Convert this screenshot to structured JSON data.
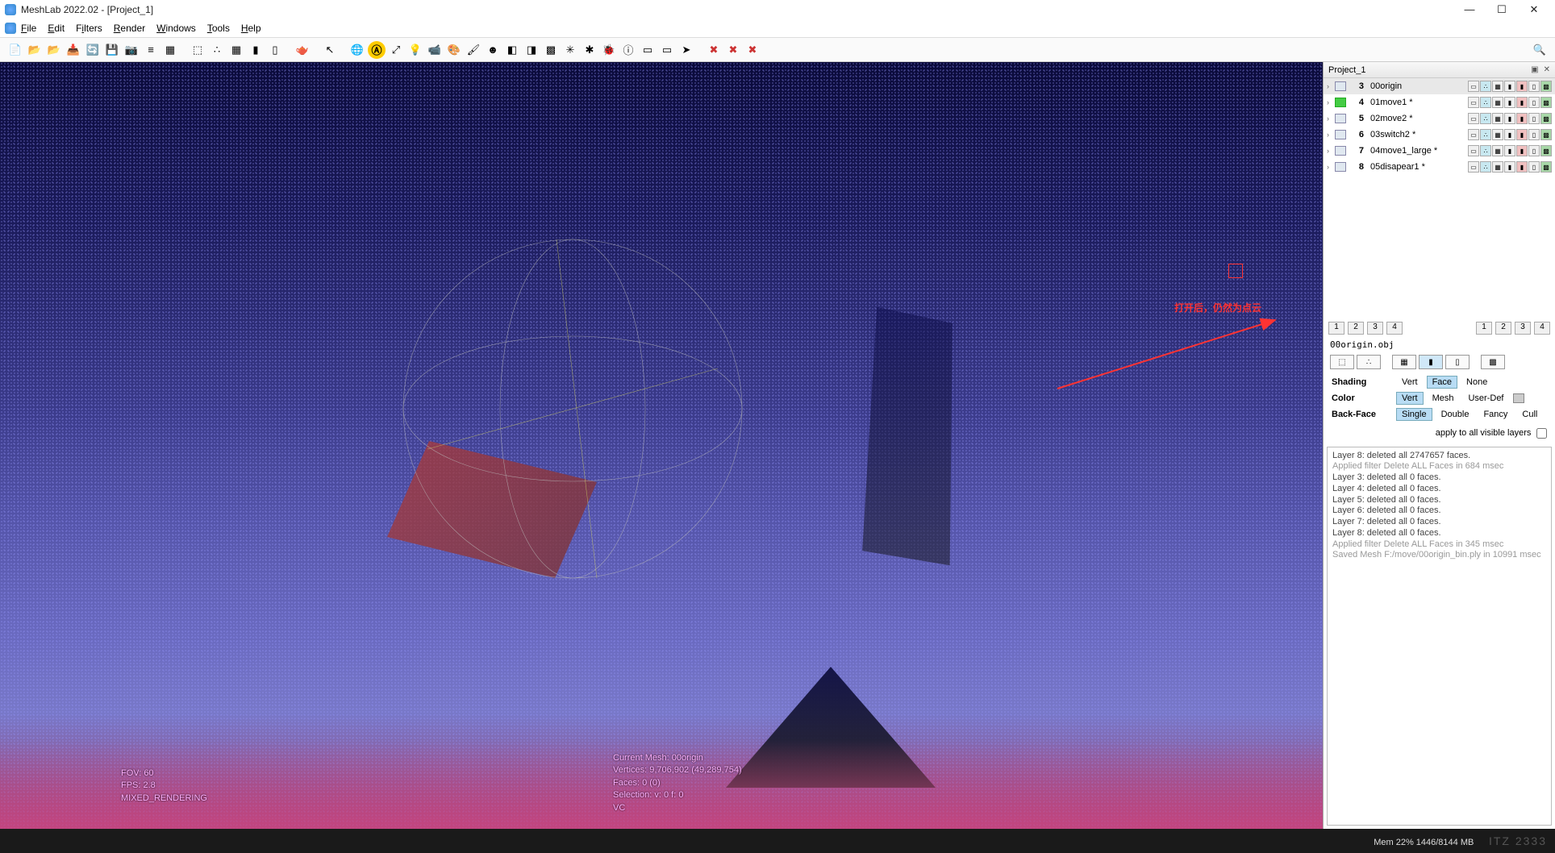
{
  "title": "MeshLab 2022.02 - [Project_1]",
  "menu": {
    "file": "File",
    "edit": "Edit",
    "filters": "Filters",
    "render": "Render",
    "windows": "Windows",
    "tools": "Tools",
    "help": "Help"
  },
  "toolbar_icons": [
    "new-icon",
    "open-icon",
    "open-folder-icon",
    "import-icon",
    "reload-icon",
    "save-icon",
    "snapshot-icon",
    "layers-icon",
    "raster-icon",
    "",
    "bbox-icon",
    "points-icon",
    "wire-icon",
    "solid-icon",
    "flat-icon",
    "",
    "teapot-icon",
    "",
    "cursor-icon",
    "",
    "globe-icon",
    "a-icon",
    "axis-icon",
    "light-icon",
    "camera-icon",
    "material-icon",
    "brush-icon",
    "face-icon",
    "vcolor-icon",
    "fcolor-icon",
    "texture-icon",
    "normals-icon",
    "bug-icon",
    "ladybug-icon",
    "info-icon",
    "mselect-icon",
    "minvert-icon",
    "arrow-icon",
    "",
    "delvert-icon",
    "delface-icon",
    "delselect-icon"
  ],
  "toolbar_glyphs": {
    "new-icon": "📄",
    "open-icon": "📂",
    "open-folder-icon": "📂",
    "import-icon": "📥",
    "reload-icon": "🔄",
    "save-icon": "💾",
    "snapshot-icon": "📷",
    "layers-icon": "≡",
    "raster-icon": "▦",
    "bbox-icon": "⬚",
    "points-icon": "∴",
    "wire-icon": "▦",
    "solid-icon": "▮",
    "flat-icon": "▯",
    "teapot-icon": "🫖",
    "cursor-icon": "↖",
    "globe-icon": "🌐",
    "a-icon": "Ⓐ",
    "axis-icon": "⤢",
    "light-icon": "💡",
    "camera-icon": "📹",
    "material-icon": "🎨",
    "brush-icon": "🖌",
    "face-icon": "☻",
    "vcolor-icon": "◧",
    "fcolor-icon": "◨",
    "texture-icon": "▩",
    "normals-icon": "✳",
    "bug-icon": "✱",
    "ladybug-icon": "🐞",
    "info-icon": "ⓘ",
    "mselect-icon": "▭",
    "minvert-icon": "▭",
    "arrow-icon": "➤",
    "delvert-icon": "✖",
    "delface-icon": "✖",
    "delselect-icon": "✖",
    "search-icon": "🔍"
  },
  "panel": {
    "title": "Project_1",
    "layers": [
      {
        "num": "3",
        "name": "00origin",
        "modified": false,
        "iconGreen": false
      },
      {
        "num": "4",
        "name": "01move1 *",
        "modified": true,
        "iconGreen": true
      },
      {
        "num": "5",
        "name": "02move2 *",
        "modified": true,
        "iconGreen": false
      },
      {
        "num": "6",
        "name": "03switch2 *",
        "modified": true,
        "iconGreen": false
      },
      {
        "num": "7",
        "name": "04move1_large *",
        "modified": true,
        "iconGreen": false
      },
      {
        "num": "8",
        "name": "05disapear1 *",
        "modified": true,
        "iconGreen": false
      }
    ],
    "annotation": "打开后，仍然为点云",
    "leftNums": [
      "1",
      "2",
      "3",
      "4"
    ],
    "rightNums": [
      "1",
      "2",
      "3",
      "4"
    ],
    "file": "00origin.obj",
    "props": {
      "shading": {
        "label": "Shading",
        "opts": [
          "Vert",
          "Face",
          "None"
        ],
        "sel": 1
      },
      "color": {
        "label": "Color",
        "opts": [
          "Vert",
          "Mesh",
          "User-Def"
        ],
        "sel": 0
      },
      "backface": {
        "label": "Back-Face",
        "opts": [
          "Single",
          "Double",
          "Fancy",
          "Cull"
        ],
        "sel": 0
      }
    },
    "applyAll": "apply to all visible layers",
    "log": [
      {
        "t": "Layer 8: deleted all 2747657 faces.",
        "dim": false
      },
      {
        "t": "Applied filter Delete ALL Faces in 684 msec",
        "dim": true
      },
      {
        "t": "Layer 3: deleted all 0 faces.",
        "dim": false
      },
      {
        "t": "Layer 4: deleted all 0 faces.",
        "dim": false
      },
      {
        "t": "Layer 5: deleted all 0 faces.",
        "dim": false
      },
      {
        "t": "Layer 6: deleted all 0 faces.",
        "dim": false
      },
      {
        "t": "Layer 7: deleted all 0 faces.",
        "dim": false
      },
      {
        "t": "Layer 8: deleted all 0 faces.",
        "dim": false
      },
      {
        "t": "Applied filter Delete ALL Faces in 345 msec",
        "dim": true
      },
      {
        "t": "Saved Mesh F:/move/00origin_bin.ply in 10991 msec",
        "dim": true
      }
    ]
  },
  "overlay": {
    "fov": "FOV: 60",
    "fps": "FPS:  2.8",
    "mode": "MIXED_RENDERING",
    "mesh": "Current Mesh: 00origin",
    "verts": "Vertices: 9,706,902   (49,289,754)",
    "faces": "Faces: 0    (0)",
    "sel": "Selection: v: 0 f: 0",
    "vc": "VC"
  },
  "status": {
    "mem": "Mem 22% 1446/8144 MB",
    "watermark": "ITZ 2333"
  }
}
